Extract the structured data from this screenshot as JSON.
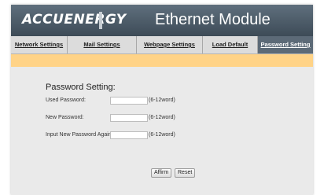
{
  "header": {
    "logo_text": "ACCUENERGY",
    "module_title": "Ethernet Module"
  },
  "tabs": [
    {
      "label": "Network Settings",
      "active": false
    },
    {
      "label": "Mail Settings",
      "active": false
    },
    {
      "label": "Webpage Settings",
      "active": false
    },
    {
      "label": "Load Default",
      "active": false
    },
    {
      "label": "Password Setting",
      "active": true
    }
  ],
  "form": {
    "title": "Password Setting:",
    "fields": [
      {
        "label": "Used Password:",
        "value": "",
        "hint": "(6-12word)"
      },
      {
        "label": "New Password:",
        "value": "",
        "hint": "(6-12word)"
      },
      {
        "label": "Input New Password Again:",
        "value": "",
        "hint": "(6-12word)"
      }
    ],
    "affirm_label": "Affirm",
    "reset_label": "Reset"
  },
  "colors": {
    "header": "#4e5d6a",
    "active_tab": "#5c6a77",
    "banner": "#ffd387",
    "panel": "#eaeaea"
  }
}
